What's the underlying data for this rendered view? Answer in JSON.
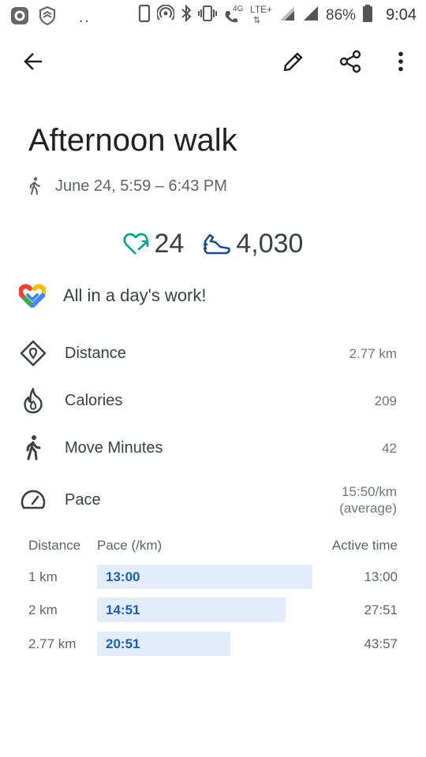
{
  "status_bar": {
    "battery": "86%",
    "time": "9:04",
    "network_4g": "4G",
    "network_lte": "LTE+",
    "notification_dots": ".."
  },
  "app_bar": {
    "back_icon": "arrow-back",
    "edit_icon": "pencil",
    "share_icon": "share",
    "more_icon": "more-vertical"
  },
  "activity": {
    "title": "Afternoon walk",
    "datetime": "June 24, 5:59 – 6:43 PM",
    "heart_points": "24",
    "steps": "4,030",
    "message": "All in a day's work!"
  },
  "metrics": [
    {
      "label": "Distance",
      "value": "2.77 km",
      "icon": "distance"
    },
    {
      "label": "Calories",
      "value": "209",
      "icon": "flame"
    },
    {
      "label": "Move Minutes",
      "value": "42",
      "icon": "walking-person"
    },
    {
      "label": "Pace",
      "value": "15:50/km",
      "value2": "(average)",
      "icon": "speedometer"
    }
  ],
  "splits": {
    "headers": {
      "distance": "Distance",
      "pace": "Pace (/km)",
      "active_time": "Active time"
    },
    "rows": [
      {
        "distance": "1 km",
        "pace": "13:00",
        "active_time": "13:00",
        "bar_fraction": 1.0
      },
      {
        "distance": "2 km",
        "pace": "14:51",
        "active_time": "27:51",
        "bar_fraction": 0.876
      },
      {
        "distance": "2.77 km",
        "pace": "20:51",
        "active_time": "43:57",
        "bar_fraction": 0.62
      }
    ]
  },
  "colors": {
    "heart_teal": "#00a38a",
    "steps_blue": "#1a4a8f",
    "pace_bar": "#e3ecfb",
    "pace_text": "#1a5fb4"
  }
}
